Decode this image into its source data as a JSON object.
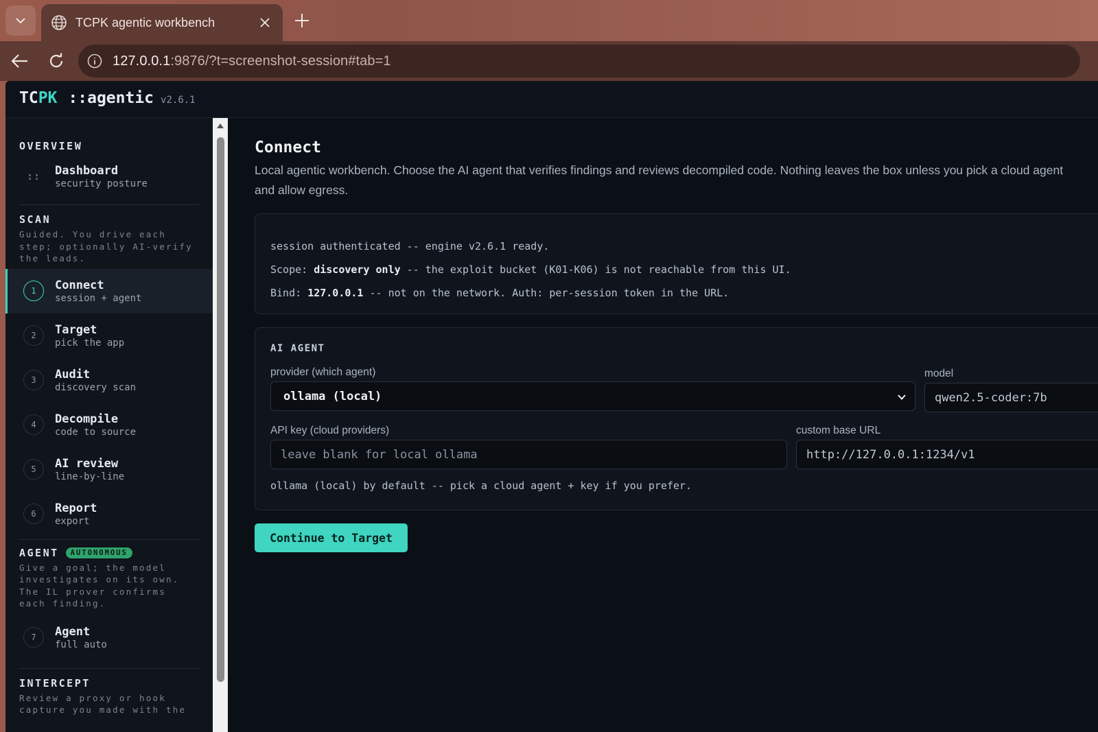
{
  "browser": {
    "tab_title": "TCPK agentic workbench",
    "url_host": "127.0.0.1",
    "url_rest": ":9876/?t=screenshot-session#tab=1"
  },
  "header": {
    "brand_a": "TC",
    "brand_b": "PK",
    "brand_sub": "::agentic",
    "version": "v2.6.1"
  },
  "sidebar": {
    "overview": {
      "title": "OVERVIEW",
      "dashboard": {
        "label": "Dashboard",
        "sub": "security posture",
        "marker": "::"
      }
    },
    "scan": {
      "title": "SCAN",
      "desc": "Guided. You drive each step; optionally AI-verify the leads.",
      "items": [
        {
          "num": "1",
          "label": "Connect",
          "sub": "session + agent"
        },
        {
          "num": "2",
          "label": "Target",
          "sub": "pick the app"
        },
        {
          "num": "3",
          "label": "Audit",
          "sub": "discovery scan"
        },
        {
          "num": "4",
          "label": "Decompile",
          "sub": "code to source"
        },
        {
          "num": "5",
          "label": "AI review",
          "sub": "line-by-line"
        },
        {
          "num": "6",
          "label": "Report",
          "sub": "export"
        }
      ]
    },
    "agent": {
      "title": "AGENT",
      "badge": "AUTONOMOUS",
      "desc": "Give a goal; the model investigates on its own. The IL prover confirms each finding.",
      "item": {
        "num": "7",
        "label": "Agent",
        "sub": "full auto"
      }
    },
    "intercept": {
      "title": "INTERCEPT",
      "desc": "Review a proxy or hook capture you made with the"
    }
  },
  "main": {
    "title": "Connect",
    "desc": "Local agentic workbench. Choose the AI agent that verifies findings and reviews decompiled code. Nothing leaves the box unless you pick a cloud agent and allow egress.",
    "session": {
      "line1": "session authenticated -- engine v2.6.1 ready.",
      "line2_pre": "Scope: ",
      "line2_bold": "discovery only",
      "line2_post": " -- the exploit bucket (K01-K06) is not reachable from this UI.",
      "line3_pre": "Bind: ",
      "line3_bold": "127.0.0.1",
      "line3_post": " -- not on the network. Auth: per-session token in the URL."
    },
    "agent": {
      "title": "AI AGENT",
      "provider_label": "provider (which agent)",
      "provider_value": "ollama (local)",
      "model_label": "model",
      "model_value": "qwen2.5-coder:7b",
      "api_key_label": "API key (cloud providers)",
      "api_key_placeholder": "leave blank for local ollama",
      "base_url_label": "custom base URL",
      "base_url_value": "http://127.0.0.1:1234/v1",
      "hint": "ollama (local) by default -- pick a cloud agent + key if you prefer."
    },
    "cta": "Continue to Target"
  },
  "colors": {
    "accent": "#3fd5c1",
    "badge": "#2fa36b",
    "background": "#0b0f16"
  }
}
